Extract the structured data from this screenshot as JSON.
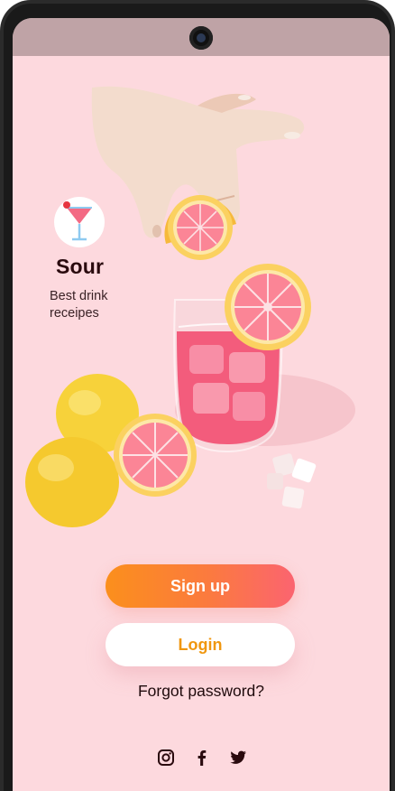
{
  "app": {
    "name": "Sour",
    "tagline": "Best drink receipes"
  },
  "actions": {
    "signup_label": "Sign up",
    "login_label": "Login",
    "forgot_label": "Forgot password?"
  },
  "social": [
    {
      "icon": "instagram-icon"
    },
    {
      "icon": "facebook-icon"
    },
    {
      "icon": "twitter-icon"
    }
  ],
  "colors": {
    "background": "#fdd9de",
    "accent_orange": "#fb8f1c",
    "accent_pink": "#fb6470",
    "login_text": "#f0970f",
    "dark_text": "#2a0a0e"
  }
}
